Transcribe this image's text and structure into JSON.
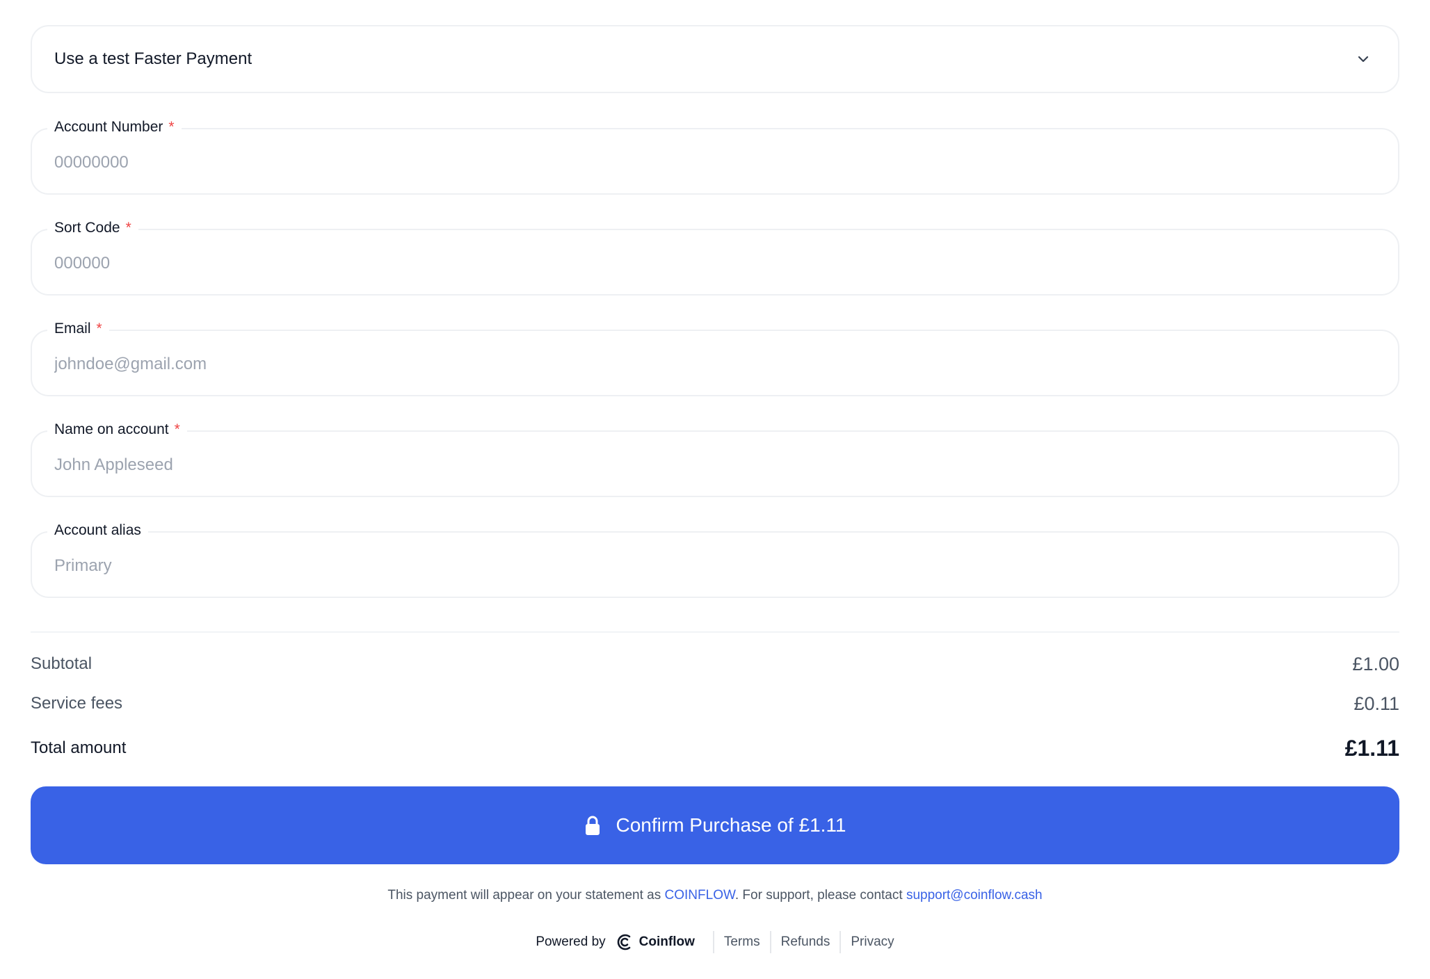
{
  "dropdown": {
    "label": "Use a test Faster Payment",
    "icon": "chevron-down-icon"
  },
  "fields": {
    "account_number": {
      "label": "Account Number",
      "required_mark": "*",
      "placeholder": "00000000"
    },
    "sort_code": {
      "label": "Sort Code",
      "required_mark": "*",
      "placeholder": "000000"
    },
    "email": {
      "label": "Email",
      "required_mark": "*",
      "placeholder": "johndoe@gmail.com"
    },
    "name_on_account": {
      "label": "Name on account",
      "required_mark": "*",
      "placeholder": "John Appleseed"
    },
    "account_alias": {
      "label": "Account alias",
      "placeholder": "Primary"
    }
  },
  "summary": {
    "subtotal_label": "Subtotal",
    "subtotal_value": "£1.00",
    "fees_label": "Service fees",
    "fees_value": "£0.11",
    "total_label": "Total amount",
    "total_value": "£1.11"
  },
  "confirm": {
    "label": "Confirm Purchase of £1.11",
    "icon": "lock-icon"
  },
  "statement": {
    "prefix": "This payment will appear on your statement as ",
    "descriptor": "COINFLOW",
    "middle": ". For support, please contact ",
    "support_email": "support@coinflow.cash"
  },
  "footer": {
    "powered_by": "Powered by",
    "brand": "Coinflow",
    "links": [
      "Terms",
      "Refunds",
      "Privacy"
    ]
  },
  "colors": {
    "accent": "#3962e6",
    "required": "#ef4444",
    "border": "#eef0f3"
  }
}
